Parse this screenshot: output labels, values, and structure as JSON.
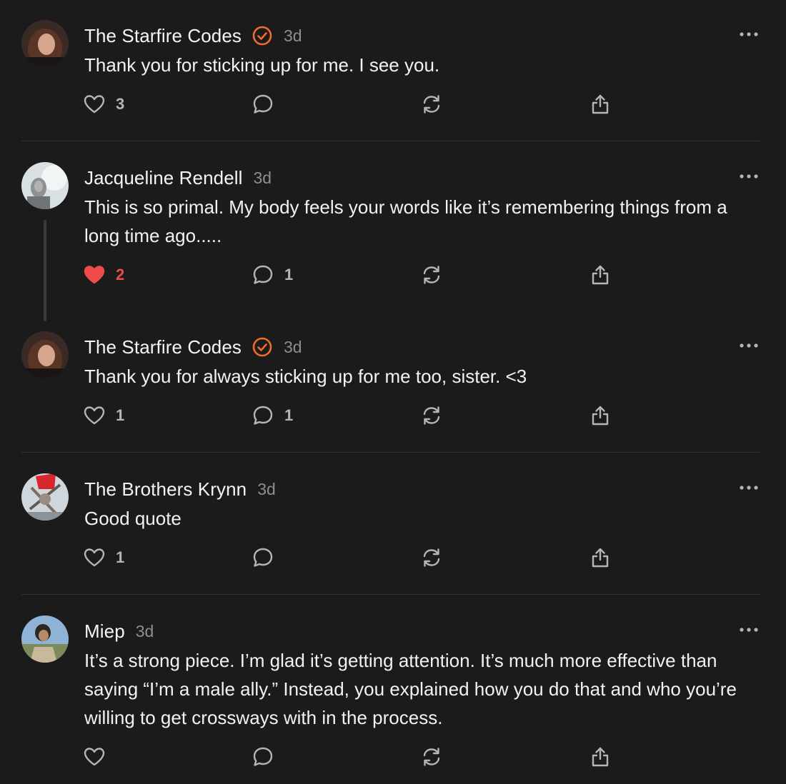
{
  "comments": [
    {
      "author": "The Starfire Codes",
      "verified": true,
      "time": "3d",
      "text": "Thank you for sticking up for me. I see you.",
      "likes": "3",
      "liked": false,
      "replies": ""
    },
    {
      "author": "Jacqueline Rendell",
      "verified": false,
      "time": "3d",
      "text": "This is so primal. My body feels your words like it’s remembering things from a long time ago.....",
      "likes": "2",
      "liked": true,
      "replies": "1"
    },
    {
      "author": "The Starfire Codes",
      "verified": true,
      "time": "3d",
      "text": "Thank you for always sticking up for me too, sister. <3",
      "likes": "1",
      "liked": false,
      "replies": "1"
    },
    {
      "author": "The Brothers Krynn",
      "verified": false,
      "time": "3d",
      "text": "Good quote",
      "likes": "1",
      "liked": false,
      "replies": ""
    },
    {
      "author": "Miep",
      "verified": false,
      "time": "3d",
      "text": "It’s a strong piece. I’m glad it’s getting attention. It’s much more effective than saying “I’m a male ally.” Instead, you explained how you do that and who you’re willing to get crossways with in the process.",
      "likes": "",
      "liked": false,
      "replies": ""
    }
  ],
  "colors": {
    "background": "#1b1b1c",
    "verified_badge": "#f26c2b",
    "liked_heart": "#ef4b4b",
    "icon": "#b5b5b5",
    "timestamp": "#8e8e8e"
  },
  "icons": {
    "like": "heart-icon",
    "reply": "comment-bubble-icon",
    "restack": "restack-icon",
    "share": "share-icon",
    "more": "more-options-icon",
    "verified": "verified-badge-icon"
  }
}
